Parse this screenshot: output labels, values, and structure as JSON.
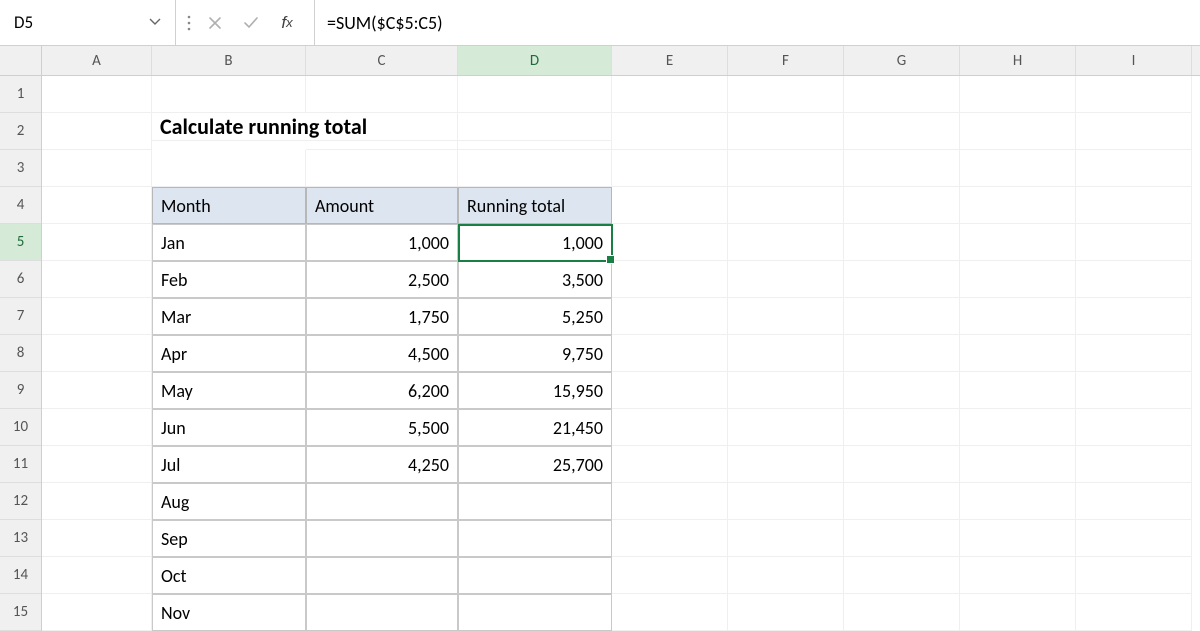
{
  "name_box": "D5",
  "formula": "=SUM($C$5:C5)",
  "active_col": "D",
  "active_row": 5,
  "columns": [
    "A",
    "B",
    "C",
    "D",
    "E",
    "F",
    "G",
    "H",
    "I"
  ],
  "row_start": 1,
  "row_end": 15,
  "title": "Calculate running total",
  "table": {
    "headers": {
      "month": "Month",
      "amount": "Amount",
      "running": "Running total"
    },
    "rows": [
      {
        "month": "Jan",
        "amount": "1,000",
        "running": "1,000"
      },
      {
        "month": "Feb",
        "amount": "2,500",
        "running": "3,500"
      },
      {
        "month": "Mar",
        "amount": "1,750",
        "running": "5,250"
      },
      {
        "month": "Apr",
        "amount": "4,500",
        "running": "9,750"
      },
      {
        "month": "May",
        "amount": "6,200",
        "running": "15,950"
      },
      {
        "month": "Jun",
        "amount": "5,500",
        "running": "21,450"
      },
      {
        "month": "Jul",
        "amount": "4,250",
        "running": "25,700"
      },
      {
        "month": "Aug",
        "amount": "",
        "running": ""
      },
      {
        "month": "Sep",
        "amount": "",
        "running": ""
      },
      {
        "month": "Oct",
        "amount": "",
        "running": ""
      },
      {
        "month": "Nov",
        "amount": "",
        "running": ""
      }
    ]
  },
  "colors": {
    "selection": "#1a7f45",
    "header_fill": "#dde5f0"
  },
  "chart_data": {
    "type": "table",
    "title": "Calculate running total",
    "columns": [
      "Month",
      "Amount",
      "Running total"
    ],
    "rows": [
      [
        "Jan",
        1000,
        1000
      ],
      [
        "Feb",
        2500,
        3500
      ],
      [
        "Mar",
        1750,
        5250
      ],
      [
        "Apr",
        4500,
        9750
      ],
      [
        "May",
        6200,
        15950
      ],
      [
        "Jun",
        5500,
        21450
      ],
      [
        "Jul",
        4250,
        25700
      ],
      [
        "Aug",
        null,
        null
      ],
      [
        "Sep",
        null,
        null
      ],
      [
        "Oct",
        null,
        null
      ],
      [
        "Nov",
        null,
        null
      ]
    ]
  }
}
